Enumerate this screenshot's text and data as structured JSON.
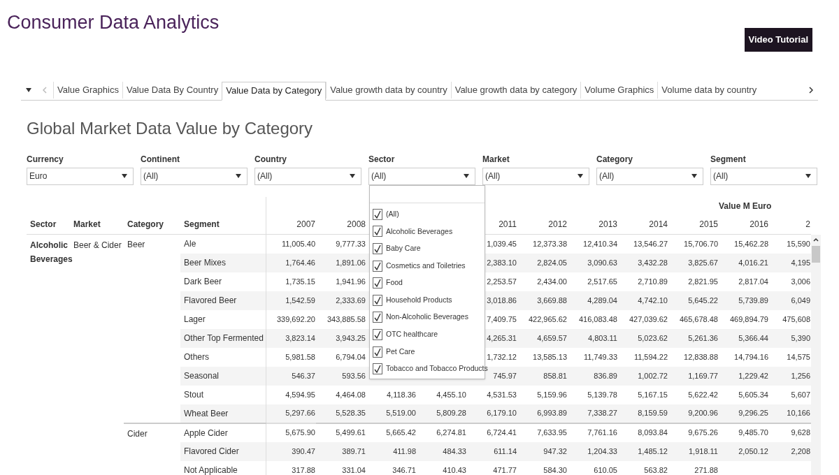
{
  "title": "Consumer Data Analytics",
  "video_button": "Video Tutorial",
  "tabs": [
    {
      "label": "Value Graphics",
      "selected": false
    },
    {
      "label": "Value Data By Country",
      "selected": false
    },
    {
      "label": "Value Data by Category",
      "selected": true
    },
    {
      "label": "Value growth data by country",
      "selected": false
    },
    {
      "label": "Value growth data by category",
      "selected": false
    },
    {
      "label": "Volume Graphics",
      "selected": false
    },
    {
      "label": "Volume data by country",
      "selected": false
    }
  ],
  "heading": "Global Market Data Value by Category",
  "filters": [
    {
      "label": "Currency",
      "value": "Euro"
    },
    {
      "label": "Continent",
      "value": "(All)"
    },
    {
      "label": "Country",
      "value": "(All)"
    },
    {
      "label": "Sector",
      "value": "(All)"
    },
    {
      "label": "Market",
      "value": "(All)"
    },
    {
      "label": "Category",
      "value": "(All)"
    },
    {
      "label": "Segment",
      "value": "(All)"
    }
  ],
  "sector_dropdown": {
    "items": [
      {
        "label": "(All)",
        "checked": true
      },
      {
        "label": "Alcoholic Beverages",
        "checked": true
      },
      {
        "label": "Baby Care",
        "checked": true
      },
      {
        "label": "Cosmetics and Toiletries",
        "checked": true
      },
      {
        "label": "Food",
        "checked": true
      },
      {
        "label": "Household Products",
        "checked": true
      },
      {
        "label": "Non-Alcoholic Beverages",
        "checked": true
      },
      {
        "label": "OTC healthcare",
        "checked": true
      },
      {
        "label": "Pet Care",
        "checked": true
      },
      {
        "label": "Tobacco and Tobacco Products",
        "checked": true
      }
    ]
  },
  "table": {
    "measure_label": "Value M Euro",
    "headers": [
      "Sector",
      "Market",
      "Category",
      "Segment"
    ],
    "years": [
      "2007",
      "2008"
    ],
    "years_after_dropdown": [
      "2011",
      "2012",
      "2013",
      "2014",
      "2015",
      "2016",
      "2"
    ],
    "sector": "Alcoholic Beverages",
    "market": "Beer & Cider",
    "categories": [
      {
        "category": "Beer",
        "rows": [
          {
            "segment": "Ale",
            "values": [
              "11,005.40",
              "9,777.33"
            ],
            "values_after_dropdown": [
              "1,039.45",
              "12,373.38",
              "12,410.34",
              "13,546.27",
              "15,706.70",
              "15,462.28",
              "15,590"
            ]
          },
          {
            "segment": "Beer Mixes",
            "values": [
              "1,764.46",
              "1,891.06"
            ],
            "values_after_dropdown": [
              "2,383.10",
              "2,824.05",
              "3,090.63",
              "3,432.28",
              "3,825.67",
              "4,016.21",
              "4,195"
            ]
          },
          {
            "segment": "Dark Beer",
            "values": [
              "1,735.15",
              "1,941.96"
            ],
            "values_after_dropdown": [
              "2,253.57",
              "2,434.00",
              "2,517.65",
              "2,710.89",
              "2,821.95",
              "2,817.04",
              "3,006"
            ]
          },
          {
            "segment": "Flavored Beer",
            "values": [
              "1,542.59",
              "2,333.69"
            ],
            "values_after_dropdown": [
              "3,018.86",
              "3,669.88",
              "4,289.04",
              "4,742.10",
              "5,645.22",
              "5,739.89",
              "6,049"
            ]
          },
          {
            "segment": "Lager",
            "values": [
              "339,692.20",
              "343,885.58"
            ],
            "values_after_dropdown": [
              "7,409.75",
              "422,965.62",
              "416,083.48",
              "427,039.62",
              "465,678.48",
              "469,894.79",
              "475,608"
            ]
          },
          {
            "segment": "Other Top Fermented",
            "values": [
              "3,823.14",
              "3,943.25"
            ],
            "values_after_dropdown": [
              "4,265.31",
              "4,659.57",
              "4,803.11",
              "5,023.62",
              "5,261.36",
              "5,366.44",
              "5,390"
            ]
          },
          {
            "segment": "Others",
            "values": [
              "5,981.58",
              "6,794.04"
            ],
            "values_after_dropdown": [
              "1,732.12",
              "13,585.13",
              "11,749.33",
              "11,594.22",
              "12,838.88",
              "14,794.16",
              "14,575"
            ]
          },
          {
            "segment": "Seasonal",
            "values": [
              "546.37",
              "593.56"
            ],
            "values_after_dropdown": [
              "745.97",
              "858.81",
              "836.89",
              "1,002.72",
              "1,169.77",
              "1,229.42",
              "1,256"
            ]
          },
          {
            "segment": "Stout",
            "values": [
              "4,594.95",
              "4,464.08",
              "4,118.36",
              "4,455.10",
              "4,531.53",
              "5,159.96",
              "5,139.78",
              "5,167.15",
              "5,622.42",
              "5,605.34",
              "5,607"
            ]
          },
          {
            "segment": "Wheat Beer",
            "values": [
              "5,297.66",
              "5,528.35",
              "5,519.00",
              "5,809.28",
              "6,179.10",
              "6,993.89",
              "7,338.27",
              "8,159.59",
              "9,200.96",
              "9,296.25",
              "10,166"
            ]
          }
        ]
      },
      {
        "category": "Cider",
        "rows": [
          {
            "segment": "Apple Cider",
            "values": [
              "5,675.90",
              "5,499.61",
              "5,665.42",
              "6,274.81",
              "6,724.41",
              "7,633.95",
              "7,761.16",
              "8,093.84",
              "9,675.26",
              "9,485.70",
              "9,628"
            ]
          },
          {
            "segment": "Flavored Cider",
            "values": [
              "390.47",
              "389.71",
              "411.98",
              "484.33",
              "611.14",
              "947.32",
              "1,204.33",
              "1,485.12",
              "1,918.11",
              "2,050.12",
              "2,208"
            ]
          },
          {
            "segment": "Not Applicable",
            "values": [
              "317.88",
              "331.04",
              "346.71",
              "410.43",
              "471.77",
              "584.30",
              "610.05",
              "563.82",
              "271.88"
            ]
          }
        ]
      }
    ]
  }
}
